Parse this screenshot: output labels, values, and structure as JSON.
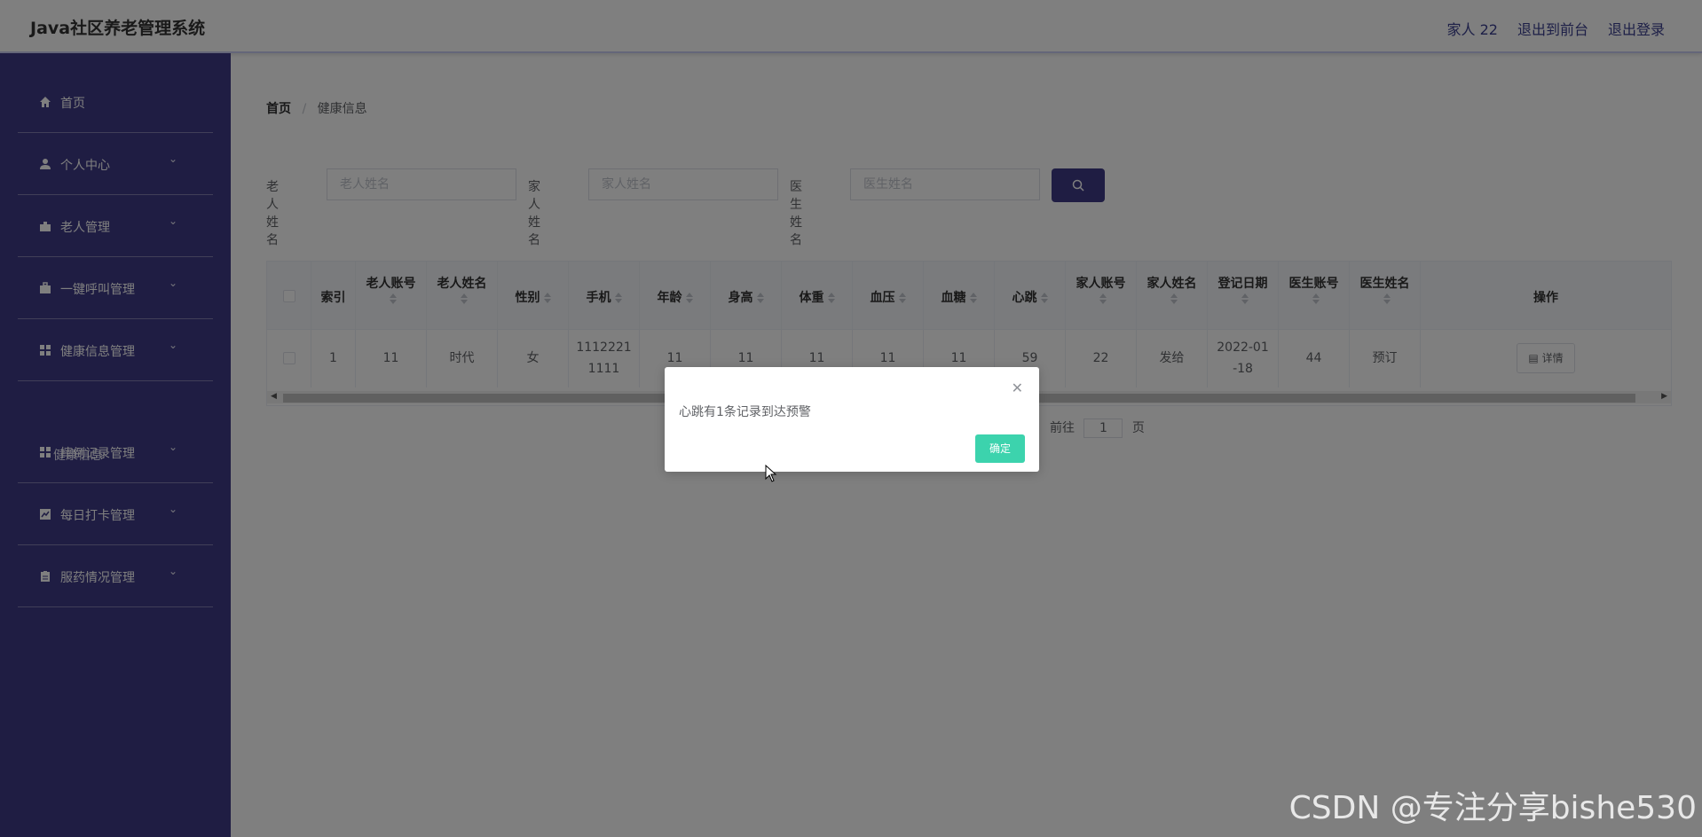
{
  "header": {
    "title": "Java社区养老管理系统",
    "links": [
      "家人 22",
      "退出到前台",
      "退出登录"
    ]
  },
  "sidebar": {
    "items": [
      {
        "label": "首页",
        "icon": "home-icon",
        "chevron": false
      },
      {
        "label": "个人中心",
        "icon": "user-icon",
        "chevron": true
      },
      {
        "label": "老人管理",
        "icon": "puzzle-icon",
        "chevron": true
      },
      {
        "label": "一键呼叫管理",
        "icon": "briefcase-icon",
        "chevron": true
      },
      {
        "label": "健康信息管理",
        "icon": "grid-icon",
        "chevron": true
      },
      {
        "label": "摔倒记录管理",
        "icon": "grid-icon",
        "chevron": true
      },
      {
        "label": "每日打卡管理",
        "icon": "chart-icon",
        "chevron": true
      },
      {
        "label": "服药情况管理",
        "icon": "clipboard-icon",
        "chevron": true
      }
    ],
    "sub_item": "健康信息"
  },
  "breadcrumb": {
    "home": "首页",
    "separator": "/",
    "current": "健康信息"
  },
  "search": {
    "fields": [
      {
        "label": "老人姓名",
        "placeholder": "老人姓名"
      },
      {
        "label": "家人姓名",
        "placeholder": "家人姓名"
      },
      {
        "label": "医生姓名",
        "placeholder": "医生姓名"
      }
    ]
  },
  "table": {
    "columns": [
      "索引",
      "老人账号",
      "老人姓名",
      "性别",
      "手机",
      "年龄",
      "身高",
      "体重",
      "血压",
      "血糖",
      "心跳",
      "家人账号",
      "家人姓名",
      "登记日期",
      "医生账号",
      "医生姓名",
      "操作"
    ],
    "row": [
      "1",
      "11",
      "时代",
      "女",
      "11122211111",
      "11",
      "11",
      "11",
      "11",
      "11",
      "59",
      "22",
      "发给",
      "2022-01-18",
      "44",
      "预订"
    ],
    "detail_label": "详情"
  },
  "pager": {
    "goto": "前往",
    "page": "1",
    "unit": "页"
  },
  "dialog": {
    "message": "心跳有1条记录到达预警",
    "ok_label": "确定"
  },
  "watermark": "CSDN @专注分享bishe530",
  "colors": {
    "sidebar": "#3f3b86",
    "accent": "#3f3b86",
    "ok_button": "#3cd3ad"
  }
}
